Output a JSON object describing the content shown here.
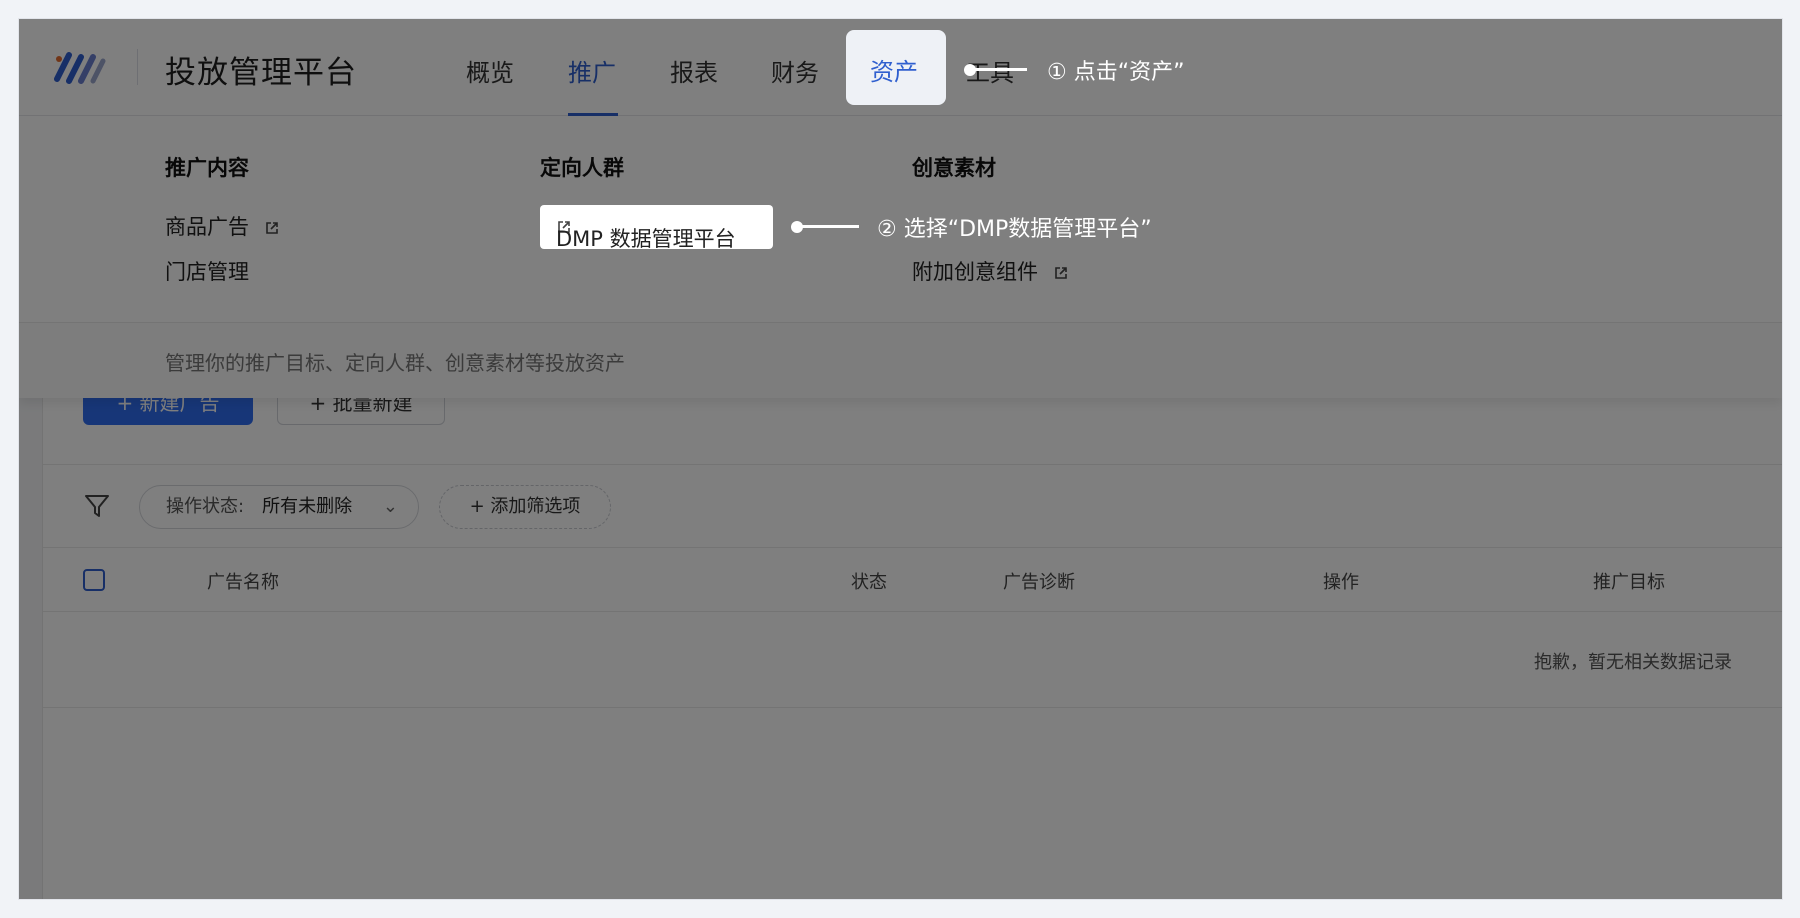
{
  "app": {
    "title": "投放管理平台"
  },
  "nav": {
    "tabs": [
      {
        "label": "概览"
      },
      {
        "label": "推广"
      },
      {
        "label": "报表"
      },
      {
        "label": "财务"
      },
      {
        "label": "资产"
      },
      {
        "label": "工具"
      }
    ],
    "active": "推广",
    "highlighted": "资产"
  },
  "dropdown": {
    "columns": [
      {
        "title": "推广内容",
        "items": [
          "商品广告",
          "门店管理"
        ]
      },
      {
        "title": "定向人群",
        "items": [
          "DMP 数据管理平台"
        ]
      },
      {
        "title": "创意素材",
        "items": [
          "附加创意组件"
        ]
      }
    ],
    "footer": "管理你的推广目标、定向人群、创意素材等投放资产"
  },
  "toolbar": {
    "new_ad": "+ 新建广告",
    "batch_new": "+ 批量新建"
  },
  "filter": {
    "status_label": "操作状态:",
    "status_value": "所有未删除",
    "add_filter": "+ 添加筛选项"
  },
  "table": {
    "headers": [
      "广告名称",
      "状态",
      "广告诊断",
      "操作",
      "推广目标"
    ],
    "empty_text": "抱歉，暂无相关数据记录"
  },
  "annotations": {
    "step1": "① 点击“资产”",
    "step2": "② 选择“DMP数据管理平台”"
  },
  "colors": {
    "primary": "#2f5fcf",
    "overlay": "rgba(0,0,0,0.5)"
  }
}
